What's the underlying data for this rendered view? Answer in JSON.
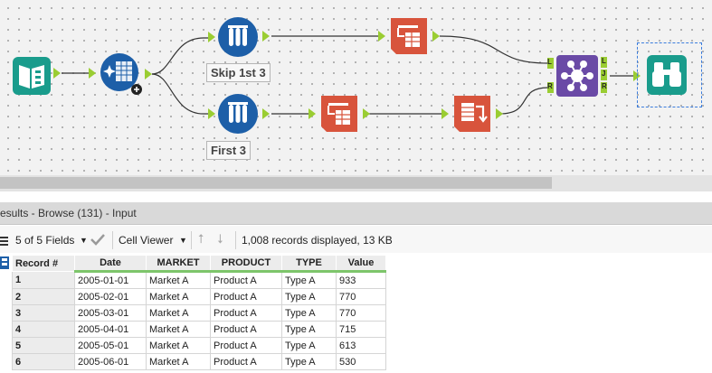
{
  "workflow": {
    "skip_label": "Skip 1st 3",
    "first_label": "First 3",
    "join_anchors": {
      "left": "L",
      "right": "R"
    },
    "join_outputs": {
      "left": "L",
      "join": "J",
      "right": "R"
    },
    "colors": {
      "input_teal": "#1a9c8c",
      "prep_blue": "#1d5fa8",
      "transform_orange": "#d8543c",
      "join_purple": "#6a4aa6",
      "anchor_green": "#9acd32"
    }
  },
  "results": {
    "title": "esults - Browse (131) - Input",
    "fields_select": "5 of 5 Fields",
    "viewer_select": "Cell Viewer",
    "status": "1,008 records displayed, 13 KB",
    "columns": [
      "Record #",
      "Date",
      "MARKET",
      "PRODUCT",
      "TYPE",
      "Value"
    ],
    "rows": [
      [
        "1",
        "2005-01-01",
        "Market A",
        "Product A",
        "Type A",
        "933"
      ],
      [
        "2",
        "2005-02-01",
        "Market A",
        "Product A",
        "Type A",
        "770"
      ],
      [
        "3",
        "2005-03-01",
        "Market A",
        "Product A",
        "Type A",
        "770"
      ],
      [
        "4",
        "2005-04-01",
        "Market A",
        "Product A",
        "Type A",
        "715"
      ],
      [
        "5",
        "2005-05-01",
        "Market A",
        "Product A",
        "Type A",
        "613"
      ],
      [
        "6",
        "2005-06-01",
        "Market A",
        "Product A",
        "Type A",
        "530"
      ]
    ]
  }
}
